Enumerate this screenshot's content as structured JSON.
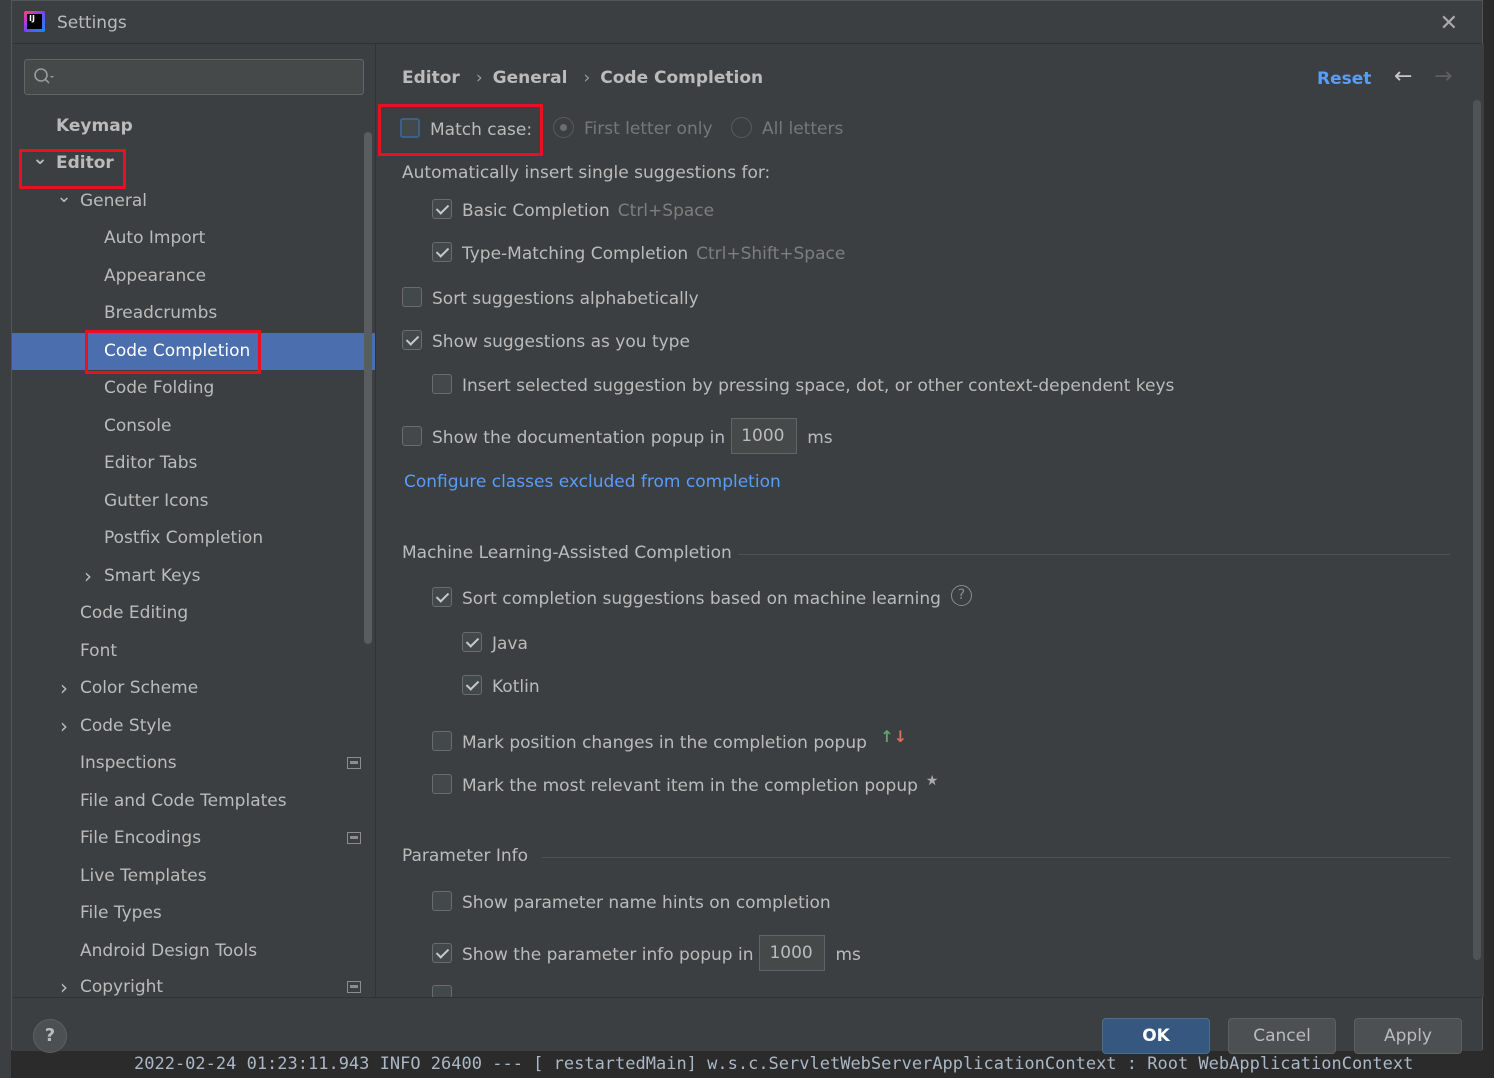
{
  "window": {
    "title": "Settings"
  },
  "search": {
    "placeholder": ""
  },
  "tree": [
    {
      "label": "Keymap",
      "indent": 0,
      "bold": true
    },
    {
      "label": "Editor",
      "indent": 0,
      "bold": true,
      "expanded": true
    },
    {
      "label": "General",
      "indent": 1,
      "expanded": true
    },
    {
      "label": "Auto Import",
      "indent": 2
    },
    {
      "label": "Appearance",
      "indent": 2
    },
    {
      "label": "Breadcrumbs",
      "indent": 2
    },
    {
      "label": "Code Completion",
      "indent": 2,
      "selected": true
    },
    {
      "label": "Code Folding",
      "indent": 2
    },
    {
      "label": "Console",
      "indent": 2
    },
    {
      "label": "Editor Tabs",
      "indent": 2
    },
    {
      "label": "Gutter Icons",
      "indent": 2
    },
    {
      "label": "Postfix Completion",
      "indent": 2
    },
    {
      "label": "Smart Keys",
      "indent": 2,
      "collapsed": true
    },
    {
      "label": "Code Editing",
      "indent": 1
    },
    {
      "label": "Font",
      "indent": 1
    },
    {
      "label": "Color Scheme",
      "indent": 1,
      "collapsed": true
    },
    {
      "label": "Code Style",
      "indent": 1,
      "collapsed": true
    },
    {
      "label": "Inspections",
      "indent": 1,
      "pageIcon": true
    },
    {
      "label": "File and Code Templates",
      "indent": 1
    },
    {
      "label": "File Encodings",
      "indent": 1,
      "pageIcon": true
    },
    {
      "label": "Live Templates",
      "indent": 1
    },
    {
      "label": "File Types",
      "indent": 1
    },
    {
      "label": "Android Design Tools",
      "indent": 1
    },
    {
      "label": "Copyright",
      "indent": 1,
      "collapsed": true,
      "pageIcon": true
    }
  ],
  "breadcrumb": {
    "items": [
      "Editor",
      "General",
      "Code Completion"
    ]
  },
  "header": {
    "reset_label": "Reset",
    "back_arrow": "←",
    "forward_arrow": "→"
  },
  "options": {
    "match_case": {
      "label": "Match case:",
      "checked": false
    },
    "first_letter": {
      "label": "First letter only"
    },
    "all_letters": {
      "label": "All letters"
    },
    "auto_insert_heading": "Automatically insert single suggestions for:",
    "basic_completion": {
      "label": "Basic Completion",
      "shortcut": "Ctrl+Space",
      "checked": true
    },
    "type_matching": {
      "label": "Type-Matching Completion",
      "shortcut": "Ctrl+Shift+Space",
      "checked": true
    },
    "sort_alpha": {
      "label": "Sort suggestions alphabetically",
      "checked": false
    },
    "show_as_type": {
      "label": "Show suggestions as you type",
      "checked": true
    },
    "insert_selected": {
      "label": "Insert selected suggestion by pressing space, dot, or other context-dependent keys",
      "checked": false
    },
    "doc_popup": {
      "label": "Show the documentation popup in",
      "value": "1000",
      "unit": "ms",
      "checked": false
    },
    "configure_link": "Configure classes excluded from completion"
  },
  "ml": {
    "heading": "Machine Learning-Assisted Completion",
    "sort_ml": {
      "label": "Sort completion suggestions based on machine learning",
      "checked": true
    },
    "java": {
      "label": "Java",
      "checked": true
    },
    "kotlin": {
      "label": "Kotlin",
      "checked": true
    },
    "mark_position": {
      "label": "Mark position changes in the completion popup",
      "checked": false,
      "up": "↑",
      "down": "↓"
    },
    "mark_relevant": {
      "label": "Mark the most relevant item in the completion popup",
      "checked": false,
      "star": "★"
    }
  },
  "param": {
    "heading": "Parameter Info",
    "name_hints": {
      "label": "Show parameter name hints on completion",
      "checked": false
    },
    "info_popup": {
      "label": "Show the parameter info popup in",
      "value": "1000",
      "unit": "ms",
      "checked": true
    }
  },
  "footer": {
    "help": "?",
    "ok": "OK",
    "cancel": "Cancel",
    "apply": "Apply"
  },
  "background": {
    "console_line": "2022-02-24 01:23:11.943  INFO 26400 --- [  restartedMain] w.s.c.ServletWebServerApplicationContext : Root WebApplicationContext"
  },
  "colors": {
    "accent": "#4b6eaf",
    "link": "#589df6",
    "highlight_box": "#e81123"
  }
}
